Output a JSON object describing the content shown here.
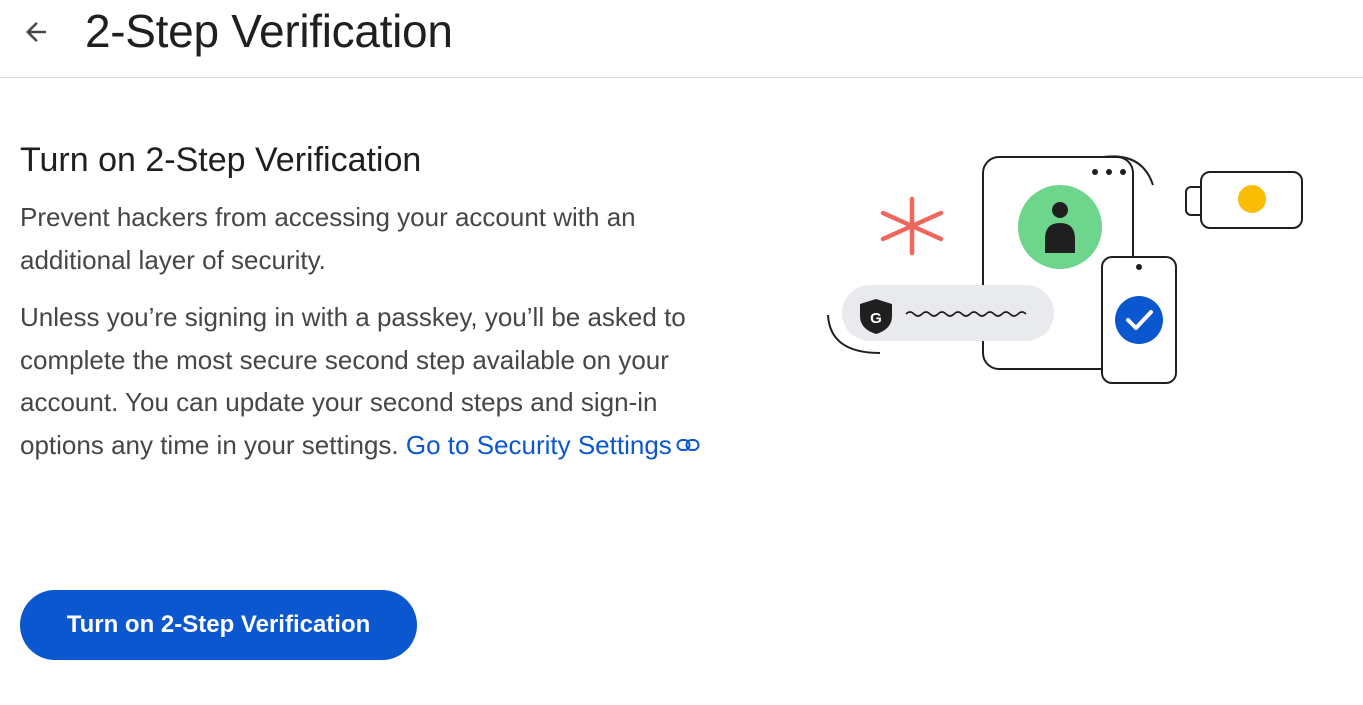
{
  "header": {
    "title": "2-Step Verification",
    "back_icon": "arrow-left-icon"
  },
  "main": {
    "heading": "Turn on 2-Step Verification",
    "intro": "Prevent hackers from accessing your account with an additional layer of security.",
    "details": "Unless you’re signing in with a passkey, you’ll be asked to complete the most secure second step available on your account. You can update your second steps and sign-in options any time in your settings.",
    "security_link_label": "Go to Security Settings",
    "link_icon": "external-link-icon",
    "primary_button_label": "Turn on 2-Step Verification"
  },
  "illustration": {
    "shield_letter": "G",
    "icons": [
      "asterisk-icon",
      "person-icon",
      "security-key-icon",
      "phone-icon",
      "check-icon",
      "shield-icon"
    ]
  },
  "colors": {
    "accent": "#0b57d0",
    "title_text": "#1f1f1f",
    "body_text": "#444746",
    "divider": "#dadce0",
    "asterisk_red": "#ee675c",
    "badge_green": "#6dd58c",
    "key_yellow": "#fbbc04"
  }
}
